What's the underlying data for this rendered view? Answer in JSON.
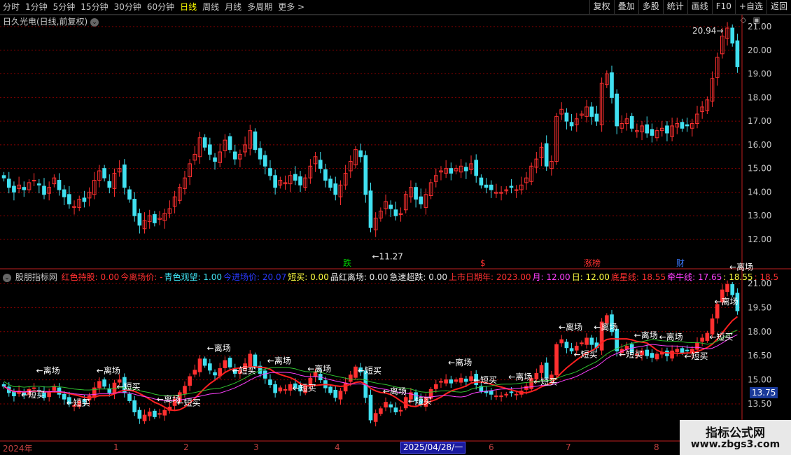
{
  "toolbar": {
    "periods": [
      "分时",
      "1分钟",
      "5分钟",
      "15分钟",
      "30分钟",
      "60分钟",
      "日线",
      "周线",
      "月线",
      "多周期",
      "更多 >"
    ],
    "active_period": "日线",
    "actions": [
      "复权",
      "叠加",
      "多股",
      "统计",
      "画线",
      "F10",
      "+自选",
      "返回"
    ]
  },
  "main_panel": {
    "title": "日久光电(日线,前复权)",
    "y_ticks": [
      "21.00",
      "20.00",
      "19.00",
      "18.00",
      "17.00",
      "16.00",
      "15.00",
      "14.00",
      "13.00",
      "12.00"
    ],
    "high_label": "20.94",
    "low_label": "11.27",
    "markers": [
      {
        "text": "跌",
        "color": "#00cc00"
      },
      {
        "text": "$",
        "color": "#ff3030"
      },
      {
        "text": "涨榜",
        "color": "#ff3030"
      },
      {
        "text": "财",
        "color": "#3a7aff"
      }
    ]
  },
  "indicator_panel": {
    "name": "股朋指标网",
    "values": [
      {
        "text": "红色持股: 0.00",
        "color": "#ff3030"
      },
      {
        "text": "今离场价: -",
        "color": "#ff3030"
      },
      {
        "text": "青色观望: 1.00",
        "color": "#40e0f0"
      },
      {
        "text": "今进场价: 20.07",
        "color": "#2a3aff"
      },
      {
        "text": "短买: 0.00",
        "color": "#ffff40"
      },
      {
        "text": "品红离场: 0.00",
        "color": "#e8e8e8"
      },
      {
        "text": "急速超跌: 0.00",
        "color": "#e8e8e8"
      },
      {
        "text": "上市日期年: 2023.00",
        "color": "#ff3030"
      },
      {
        "text": "月: 12.00",
        "color": "#ff40ff"
      },
      {
        "text": "日: 12.00",
        "color": "#ffff40"
      },
      {
        "text": "底星线: 18.55",
        "color": "#ff3030"
      },
      {
        "text": "牵牛线: 17.65",
        "color": "#ff40ff"
      },
      {
        "text": ": 18.55",
        "color": "#ffff40"
      },
      {
        "text": ": 18.5",
        "color": "#ff3030"
      }
    ],
    "y_ticks": [
      "21.00",
      "19.50",
      "18.00",
      "16.50",
      "15.00",
      "13.50"
    ],
    "current_price": "13.75",
    "signal_leave": "←离场",
    "signal_buy": "←短买"
  },
  "x_axis": {
    "labels": [
      "2024年",
      "1",
      "2",
      "3",
      "4",
      "6",
      "7",
      "8"
    ],
    "cursor_date": "2025/04/28/一"
  },
  "watermark": {
    "line1": "指标公式网",
    "line2": "www.zbgs3.com"
  },
  "colors": {
    "up": "#ff3030",
    "down": "#40e0f0",
    "grid": "#8a0000",
    "axis": "#c02020"
  },
  "chart_data": {
    "type": "candlestick",
    "closes": [
      14.6,
      14.2,
      14.0,
      14.3,
      14.1,
      14.4,
      14.5,
      14.3,
      13.9,
      14.2,
      14.6,
      14.1,
      13.8,
      13.5,
      13.4,
      13.7,
      13.6,
      14.0,
      14.5,
      14.9,
      14.6,
      14.2,
      14.8,
      15.0,
      14.2,
      13.7,
      13.0,
      12.6,
      12.8,
      13.0,
      12.7,
      12.9,
      13.1,
      13.3,
      13.8,
      14.2,
      14.6,
      15.2,
      15.6,
      16.3,
      15.9,
      15.6,
      15.3,
      15.7,
      16.2,
      15.8,
      15.4,
      15.6,
      16.0,
      16.6,
      15.8,
      15.4,
      15.1,
      14.7,
      14.2,
      14.5,
      14.4,
      14.7,
      14.5,
      14.3,
      14.6,
      15.1,
      15.5,
      15.0,
      14.5,
      14.2,
      13.9,
      14.3,
      14.8,
      15.3,
      15.8,
      15.5,
      13.9,
      12.5,
      12.9,
      13.2,
      13.6,
      13.3,
      13.0,
      13.1,
      13.9,
      14.2,
      13.7,
      13.5,
      13.9,
      14.4,
      14.7,
      14.9,
      15.0,
      14.8,
      15.0,
      15.1,
      14.9,
      15.2,
      14.7,
      14.3,
      14.2,
      14.1,
      14.0,
      14.0,
      14.1,
      14.2,
      14.1,
      14.3,
      14.6,
      15.1,
      15.4,
      15.9,
      15.1,
      15.3,
      17.2,
      17.5,
      17.0,
      16.8,
      17.1,
      17.3,
      17.6,
      17.2,
      17.0,
      18.6,
      19.0,
      18.0,
      16.8,
      16.9,
      17.1,
      16.7,
      16.6,
      16.8,
      16.5,
      16.4,
      16.6,
      16.7,
      16.5,
      16.8,
      16.9,
      16.7,
      16.8,
      16.9,
      17.3,
      17.6,
      17.9,
      18.8,
      19.7,
      20.6,
      20.94,
      20.3,
      19.3
    ],
    "y_range": [
      11.5,
      21.4
    ]
  }
}
